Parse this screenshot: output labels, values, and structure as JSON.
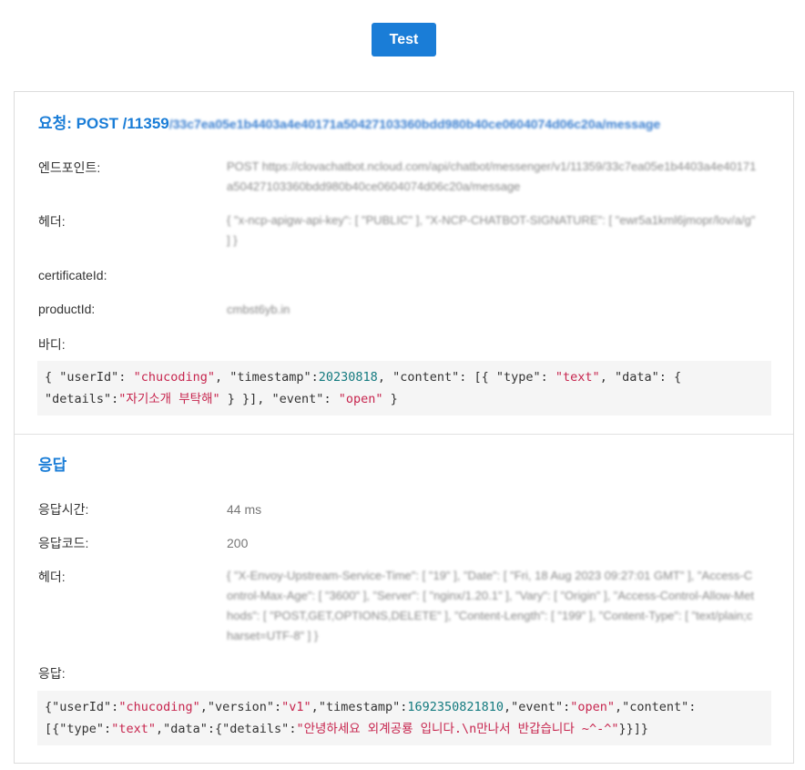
{
  "toolbar": {
    "test_label": "Test"
  },
  "request": {
    "title_prefix": "요청: POST /11359",
    "title_path": "/33c7ea05e1b4403a4e40171a50427103360bdd980b40ce0604074d06c20a/message",
    "endpoint_label": "엔드포인트:",
    "endpoint_value": "POST https://clovachatbot.ncloud.com/api/chatbot/messenger/v1/11359/33c7ea05e1b4403a4e40171a50427103360bdd980b40ce0604074d06c20a/message",
    "header_label": "헤더:",
    "header_value": "{ \"x-ncp-apigw-api-key\": [ \"PUBLIC\" ], \"X-NCP-CHATBOT-SIGNATURE\": [ \"ewr5a1kml6jmopr/lov/a/g\" ] }",
    "certificate_label": "certificateId:",
    "product_label": "productId:",
    "product_value": "cmbst6yb.in",
    "body_label": "바디:"
  },
  "request_body": {
    "k_userId": "\"userId\"",
    "v_userId": "\"chucoding\"",
    "k_timestamp": "\"timestamp\"",
    "v_timestamp": "20230818",
    "k_content": "\"content\"",
    "k_type": "\"type\"",
    "v_type": "\"text\"",
    "k_data": "\"data\"",
    "k_details": "\"details\"",
    "v_details": "\"자기소개 부탁해\"",
    "k_event": "\"event\"",
    "v_event": "\"open\""
  },
  "response": {
    "title": "응답",
    "time_label": "응답시간:",
    "time_value": "44 ms",
    "code_label": "응답코드:",
    "code_value": "200",
    "header_label": "헤더:",
    "header_value": "{ \"X-Envoy-Upstream-Service-Time\": [ \"19\" ], \"Date\": [ \"Fri, 18 Aug 2023 09:27:01 GMT\" ], \"Access-Control-Max-Age\": [ \"3600\" ], \"Server\": [ \"nginx/1.20.1\" ], \"Vary\": [ \"Origin\" ], \"Access-Control-Allow-Methods\": [ \"POST,GET,OPTIONS,DELETE\" ], \"Content-Length\": [ \"199\" ], \"Content-Type\": [ \"text/plain;charset=UTF-8\" ] }",
    "body_label": "응답:"
  },
  "response_body": {
    "k_userId": "\"userId\"",
    "v_userId": "\"chucoding\"",
    "k_version": "\"version\"",
    "v_version": "\"v1\"",
    "k_timestamp": "\"timestamp\"",
    "v_timestamp": "1692350821810",
    "k_event": "\"event\"",
    "v_event": "\"open\"",
    "k_content": "\"content\"",
    "k_type": "\"type\"",
    "v_type": "\"text\"",
    "k_data": "\"data\"",
    "k_details": "\"details\"",
    "v_details": "\"안녕하세요 외계공룡 입니다.\\n만나서 반갑습니다 ~^-^\""
  }
}
